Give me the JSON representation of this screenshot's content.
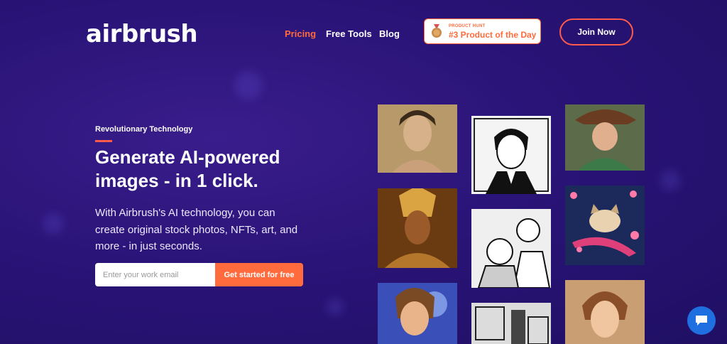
{
  "brand": {
    "logo_text": "airbrush"
  },
  "nav": {
    "items": [
      {
        "label": "Pricing",
        "active": true
      },
      {
        "label": "Free Tools",
        "active": false
      },
      {
        "label": "Blog",
        "active": false
      }
    ]
  },
  "product_hunt": {
    "small_label": "PRODUCT HUNT",
    "rank_label": "#3 Product of the Day"
  },
  "join_button": {
    "label": "Join Now"
  },
  "hero": {
    "kicker": "Revolutionary Technology",
    "headline_line1": "Generate AI-powered",
    "headline_line2": "images - in 1 click.",
    "desc_line1": "With Airbrush's AI technology, you can",
    "desc_line2": "create original stock photos, NFTs, art, and",
    "desc_line3": "more - in just seconds."
  },
  "signup": {
    "email_placeholder": "Enter your work email",
    "email_value": "",
    "cta_label": "Get started for free"
  },
  "gallery": {
    "images": [
      {
        "name": "portrait-woman-painting"
      },
      {
        "name": "sketch-man-portrait"
      },
      {
        "name": "woman-with-hat"
      },
      {
        "name": "golden-warrior"
      },
      {
        "name": "comic-kids"
      },
      {
        "name": "grumpy-cat-art"
      },
      {
        "name": "cartoon-girl"
      },
      {
        "name": "sketch-interior"
      },
      {
        "name": "woman-portrait"
      }
    ]
  },
  "colors": {
    "accent": "#ff6b3d",
    "background": "#2a1478",
    "chat": "#1f6fe0"
  },
  "chat": {
    "icon": "chat-bubble-icon"
  }
}
